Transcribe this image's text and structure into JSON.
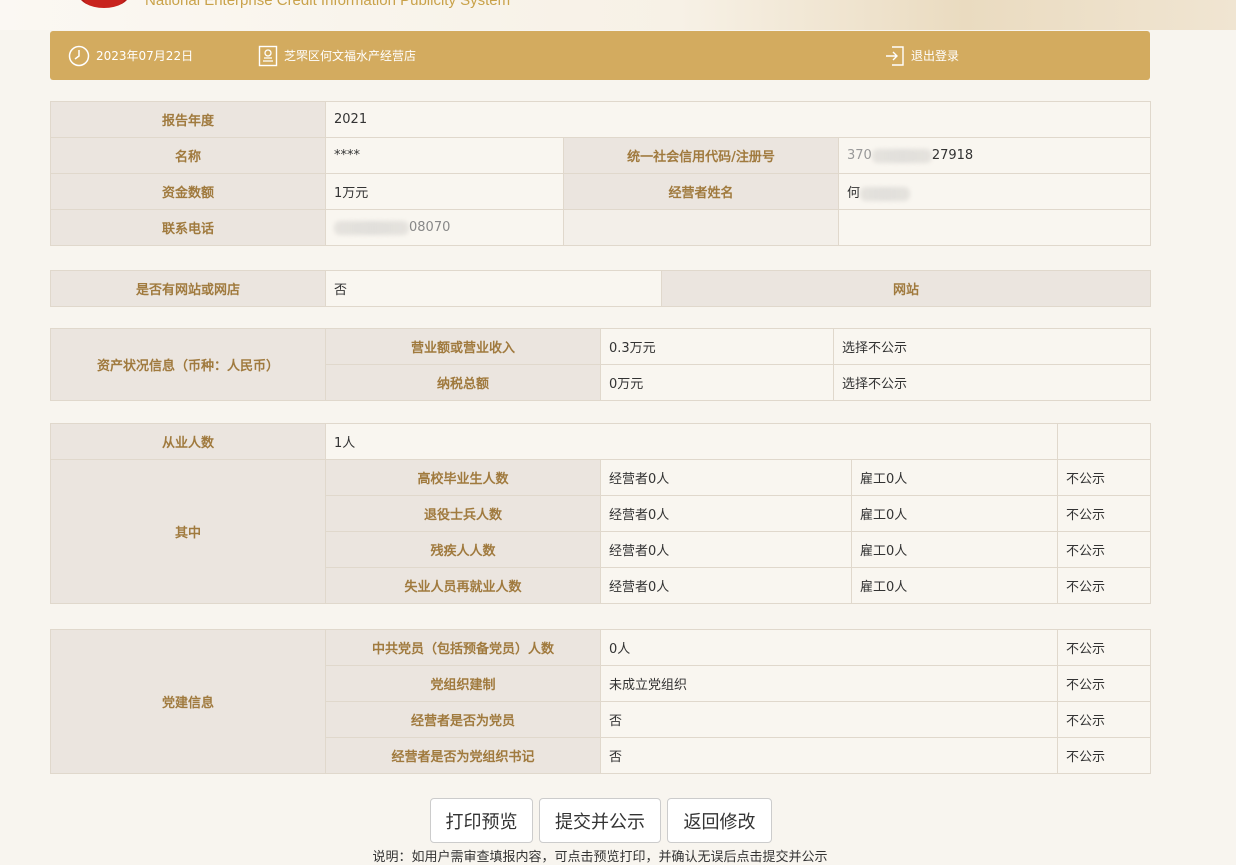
{
  "header": {
    "system_title": "National Enterprise Credit Information Publicity System"
  },
  "toolbar": {
    "date": "2023年07月22日",
    "store_name": "芝罘区何文福水产经营店",
    "logout_label": "退出登录"
  },
  "basic": {
    "report_year_label": "报告年度",
    "report_year": "2021",
    "name_label": "名称",
    "name": "****",
    "credit_code_label": "统一社会信用代码/注册号",
    "credit_code_prefix": "370",
    "credit_code_suffix": "27918",
    "capital_label": "资金数额",
    "capital": "1万元",
    "operator_label": "经营者姓名",
    "operator_name": "何",
    "phone_label": "联系电话",
    "phone_suffix": "08070"
  },
  "website": {
    "label": "是否有网站或网店",
    "value": "否",
    "site_label": "网站"
  },
  "assets": {
    "section_label": "资产状况信息（币种：人民币）",
    "rows": [
      {
        "label": "营业额或营业收入",
        "value": "0.3万元",
        "public": "选择不公示"
      },
      {
        "label": "纳税总额",
        "value": "0万元",
        "public": "选择不公示"
      }
    ]
  },
  "employees": {
    "label": "从业人数",
    "value": "1人",
    "sub_label": "其中",
    "rows": [
      {
        "label": "高校毕业生人数",
        "operator": "经营者0人",
        "employee": "雇工0人",
        "public": "不公示"
      },
      {
        "label": "退役士兵人数",
        "operator": "经营者0人",
        "employee": "雇工0人",
        "public": "不公示"
      },
      {
        "label": "残疾人人数",
        "operator": "经营者0人",
        "employee": "雇工0人",
        "public": "不公示"
      },
      {
        "label": "失业人员再就业人数",
        "operator": "经营者0人",
        "employee": "雇工0人",
        "public": "不公示"
      }
    ]
  },
  "party": {
    "section_label": "党建信息",
    "rows": [
      {
        "label": "中共党员（包括预备党员）人数",
        "value": "0人",
        "public": "不公示"
      },
      {
        "label": "党组织建制",
        "value": "未成立党组织",
        "public": "不公示"
      },
      {
        "label": "经营者是否为党员",
        "value": "否",
        "public": "不公示"
      },
      {
        "label": "经营者是否为党组织书记",
        "value": "否",
        "public": "不公示"
      }
    ]
  },
  "actions": {
    "print_preview": "打印预览",
    "submit_publish": "提交并公示",
    "back_edit": "返回修改"
  },
  "note": "说明：如用户需审查填报内容，可点击预览打印，并确认无误后点击提交并公示"
}
